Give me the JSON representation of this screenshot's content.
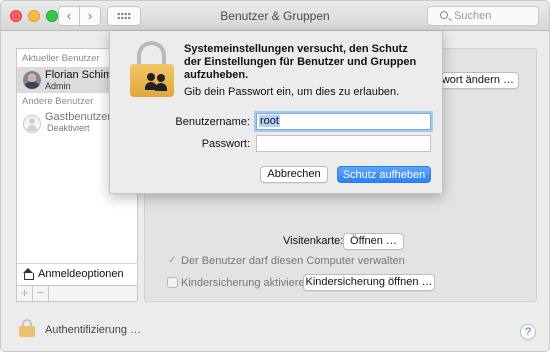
{
  "window": {
    "title": "Benutzer & Gruppen",
    "search_placeholder": "Suchen"
  },
  "sidebar": {
    "current_users_label": "Aktueller Benutzer",
    "current_user": {
      "name": "Florian Schima",
      "role": "Admin"
    },
    "other_users_label": "Andere Benutzer",
    "guest_user": {
      "name": "Gastbenutzer",
      "status": "Deaktiviert"
    },
    "login_options_label": "Anmeldeoptionen",
    "add_symbol": "+",
    "remove_symbol": "−"
  },
  "panel": {
    "change_password_label": "sswort ändern …",
    "contact_card_label": "Visitenkarte:",
    "open_label": "Öffnen …",
    "admin_checkbox_label": "Der Benutzer darf diesen Computer verwalten",
    "admin_checked": true,
    "parental_checkbox_label": "Kindersicherung aktivieren",
    "parental_checked": false,
    "open_parental_label": "Kindersicherung öffnen …"
  },
  "footer": {
    "auth_label": "Authentifizierung …",
    "help_symbol": "?"
  },
  "sheet": {
    "title": "Systemeinstellungen versucht, den Schutz der Einstellungen für Benutzer und Gruppen aufzuheben.",
    "subtitle": "Gib dein Passwort ein, um dies zu erlauben.",
    "username_label": "Benutzername:",
    "username_value": "root",
    "password_label": "Passwort:",
    "password_value": "",
    "cancel_label": "Abbrechen",
    "unlock_label": "Schutz aufheben"
  },
  "colors": {
    "accent": "#2b82f5",
    "lock_gold": "#e8b54f"
  }
}
